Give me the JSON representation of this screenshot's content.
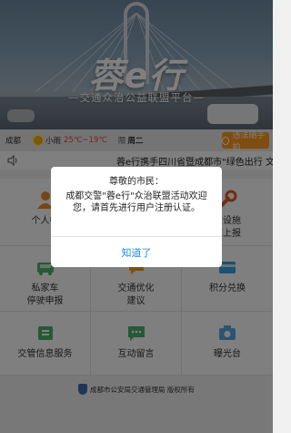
{
  "hero": {
    "title": "蓉e行",
    "subtitle": "—交通众治公益联盟平台—"
  },
  "weather": {
    "city": "成都",
    "condition": "小雨",
    "temperature": "25℃~19℃",
    "restriction_label": "限",
    "restriction_day": "周二",
    "report_button": "违法随手拍"
  },
  "notice": {
    "icon": "speaker-icon",
    "text": "蓉e行携手四川省暨成都市\"绿色出行 文"
  },
  "grid": {
    "items": [
      {
        "label": "个人中",
        "icon": "person-icon",
        "color": "#f08a2c"
      },
      {
        "label": "",
        "icon": "placeholder",
        "color": "#ffffff"
      },
      {
        "label": "交设施\n障上报",
        "icon": "wrench-icon",
        "color": "#e8542f"
      },
      {
        "label": "私家车\n停驶申报",
        "icon": "car-icon",
        "color": "#4cb26a"
      },
      {
        "label": "交通优化\n建议",
        "icon": "chat-icon",
        "color": "#f0a12c"
      },
      {
        "label": "积分兑换",
        "icon": "card-icon",
        "color": "#3aa3e3"
      },
      {
        "label": "交管信息服务",
        "icon": "info-icon",
        "color": "#4cb26a"
      },
      {
        "label": "互动留言",
        "icon": "message-icon",
        "color": "#4cb26a"
      },
      {
        "label": "曝光台",
        "icon": "camera-icon",
        "color": "#5aa6e8"
      }
    ]
  },
  "footer": {
    "text": "成都市公安局交通管理局 版权所有"
  },
  "dialog": {
    "greeting": "尊敬的市民：",
    "message": "成都交警\"蓉e行\"众治联盟活动欢迎您，请首先进行用户注册认证。",
    "confirm_label": "知道了"
  },
  "colors": {
    "accent_orange": "#ff9a1e",
    "link_blue": "#1f8ce6",
    "temp_red": "#e84c3d"
  }
}
